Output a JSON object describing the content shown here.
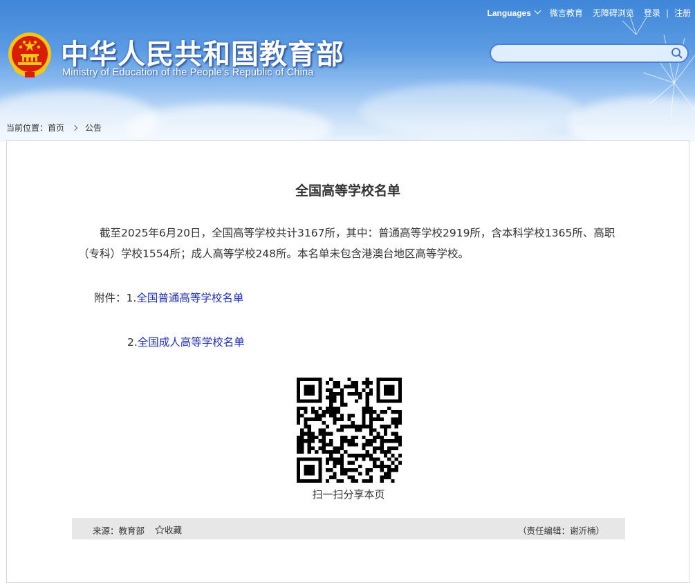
{
  "header": {
    "title": "中华人民共和国教育部",
    "subtitle": "Ministry of Education of the People's Republic of China",
    "nav": {
      "languages": "Languages",
      "weiyan": "微言教育",
      "accessibility": "无障碍浏览",
      "login": "登录",
      "separator": "|",
      "register": "注册"
    },
    "search": {
      "placeholder": "",
      "icon": "search-icon"
    }
  },
  "breadcrumb": {
    "prefix": "当前位置：",
    "home": "首页",
    "current": "公告"
  },
  "article": {
    "title": "全国高等学校名单",
    "paragraph": "截至2025年6月20日，全国高等学校共计3167所，其中：普通高等学校2919所，含本科学校1365所、高职（专科）学校1554所；成人高等学校248所。本名单未包含港澳台地区高等学校。",
    "attachments_label": "附件：",
    "attachments": [
      {
        "prefix": "1.",
        "label": "全国普通高等学校名单"
      },
      {
        "prefix": "2.",
        "label": "全国成人高等学校名单"
      }
    ],
    "qr_caption": "扫一扫分享本页"
  },
  "footer": {
    "source": "来源：教育部",
    "favorite": "收藏",
    "editor": "（责任编辑：谢沂楠）"
  },
  "colors": {
    "header_blue": "#3f86d8",
    "link": "#1f2fb8",
    "text": "#333333",
    "footer_bg": "#e7e7e7",
    "emblem_red": "#d81e06",
    "emblem_gold": "#f5c518"
  }
}
